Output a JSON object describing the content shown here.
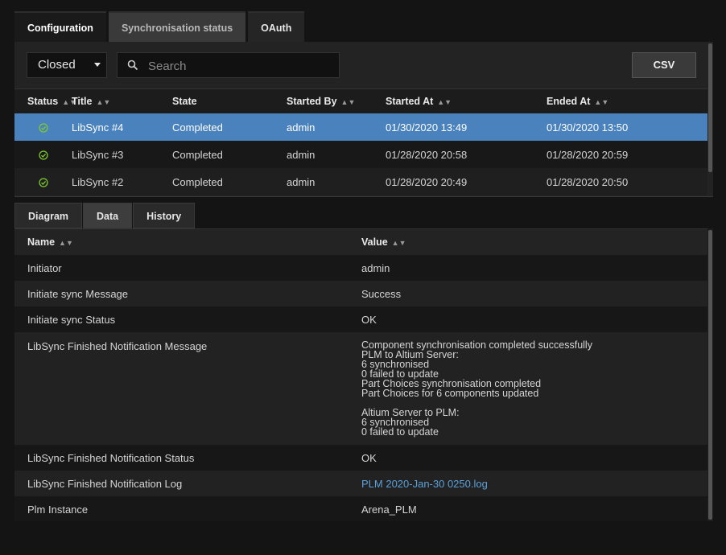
{
  "top_tabs": [
    "Configuration",
    "Synchronisation status",
    "OAuth"
  ],
  "filter": {
    "selected": "Closed"
  },
  "search": {
    "placeholder": "Search"
  },
  "csv_label": "CSV",
  "jobs": {
    "columns": [
      "Status",
      "Title",
      "State",
      "Started By",
      "Started At",
      "Ended At"
    ],
    "rows": [
      {
        "title": "LibSync #4",
        "state": "Completed",
        "started_by": "admin",
        "started_at": "01/30/2020 13:49",
        "ended_at": "01/30/2020 13:50"
      },
      {
        "title": "LibSync #3",
        "state": "Completed",
        "started_by": "admin",
        "started_at": "01/28/2020 20:58",
        "ended_at": "01/28/2020 20:59"
      },
      {
        "title": "LibSync #2",
        "state": "Completed",
        "started_by": "admin",
        "started_at": "01/28/2020 20:49",
        "ended_at": "01/28/2020 20:50"
      }
    ],
    "selected_index": 0
  },
  "sub_tabs": [
    "Diagram",
    "Data",
    "History"
  ],
  "data_table": {
    "columns": [
      "Name",
      "Value"
    ],
    "rows": [
      {
        "name": "Initiator",
        "value": "admin"
      },
      {
        "name": "Initiate sync Message",
        "value": "Success"
      },
      {
        "name": "Initiate sync Status",
        "value": "OK"
      },
      {
        "name": "LibSync Finished Notification Message",
        "value": "Component synchronisation completed successfully\nPLM to Altium Server:\n6 synchronised\n0 failed to update\nPart Choices synchronisation completed\nPart Choices for 6 components updated\n\nAltium Server to PLM:\n6 synchronised\n0 failed to update"
      },
      {
        "name": "LibSync Finished Notification Status",
        "value": "OK"
      },
      {
        "name": "LibSync Finished Notification Log",
        "value": "PLM 2020-Jan-30 0250.log"
      },
      {
        "name": "Plm Instance",
        "value": "Arena_PLM"
      }
    ]
  },
  "colors": {
    "accent_selected_row": "#4a82bd",
    "status_ok": "#7ec832",
    "link": "#5aa1d9"
  }
}
